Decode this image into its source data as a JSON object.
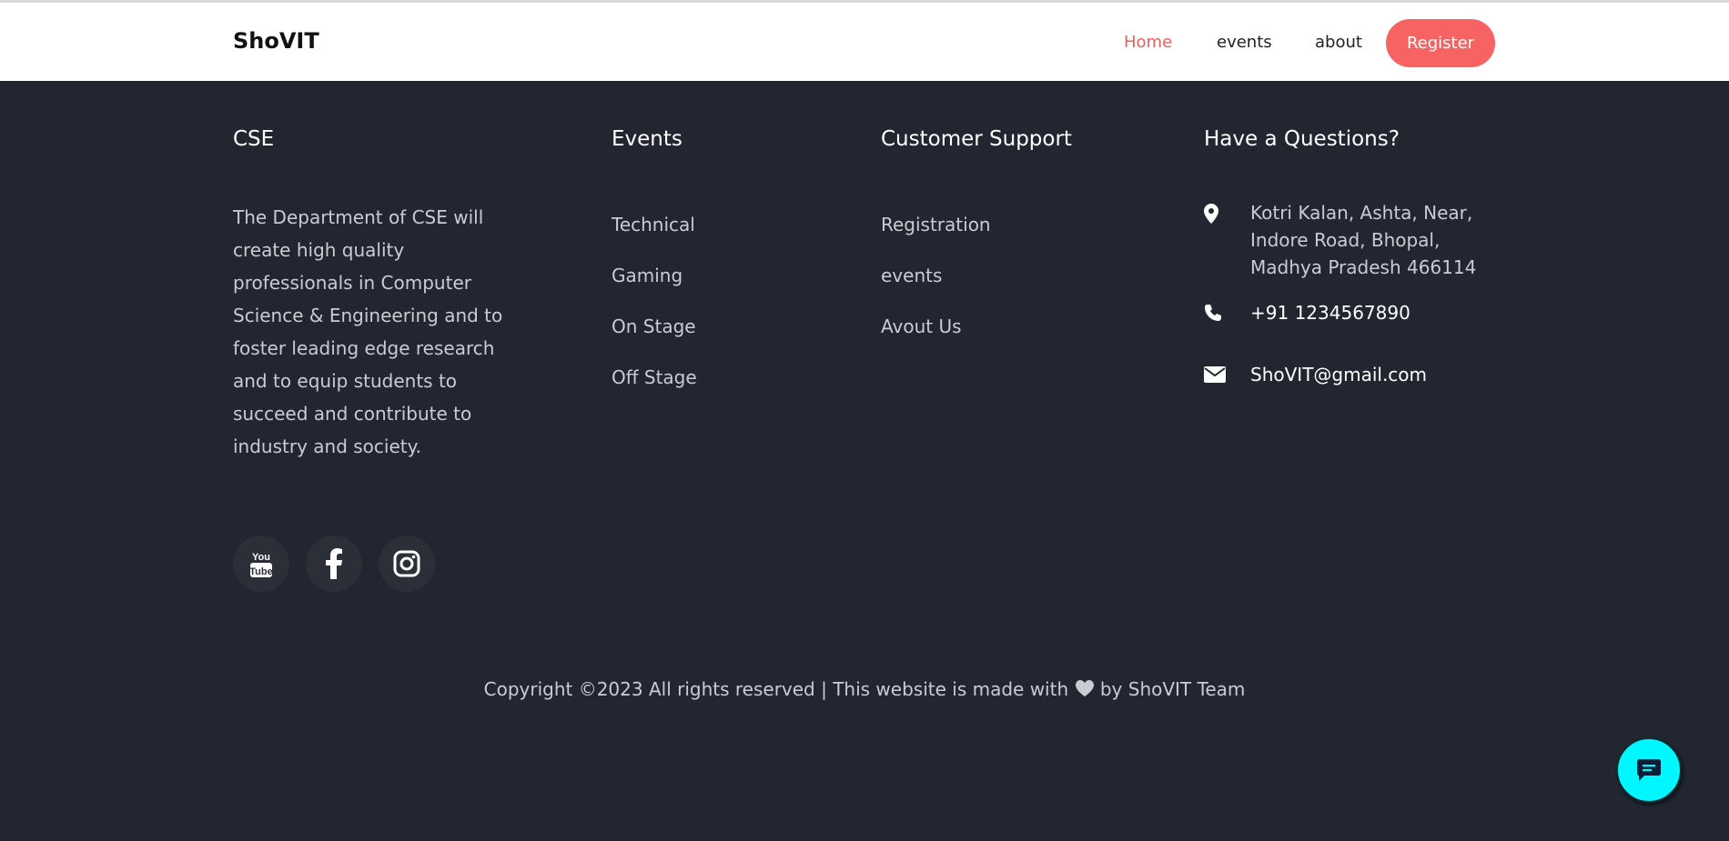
{
  "navbar": {
    "brand": "ShoVIT",
    "links": [
      "Home",
      "events",
      "about"
    ],
    "register_label": "Register",
    "active_color": "#f25b5b"
  },
  "footer": {
    "about": {
      "title": "CSE",
      "text": "The Department of CSE will create high quality professionals in Computer Science & Engineering and to foster leading edge research and to equip students to succeed and contribute to industry and society."
    },
    "events": {
      "title": "Events",
      "items": [
        "Technical",
        "Gaming",
        "On Stage",
        "Off Stage"
      ]
    },
    "support": {
      "title": "Customer Support",
      "items": [
        "Registration",
        "events",
        "Avout Us"
      ]
    },
    "contact": {
      "title": "Have a Questions?",
      "address": "Kotri Kalan, Ashta, Near, Indore Road, Bhopal, Madhya Pradesh 466114",
      "phone": "+91 1234567890",
      "email": "ShoVIT@gmail.com"
    },
    "social_icons": [
      "youtube-icon",
      "facebook-icon",
      "instagram-icon"
    ],
    "copyright_before": "Copyright ©2023 All rights reserved | This website is made with",
    "copyright_after": "by ShoVIT Team"
  },
  "chat": {
    "icon": "chat-bubble-icon",
    "color": "#00f7ff"
  }
}
